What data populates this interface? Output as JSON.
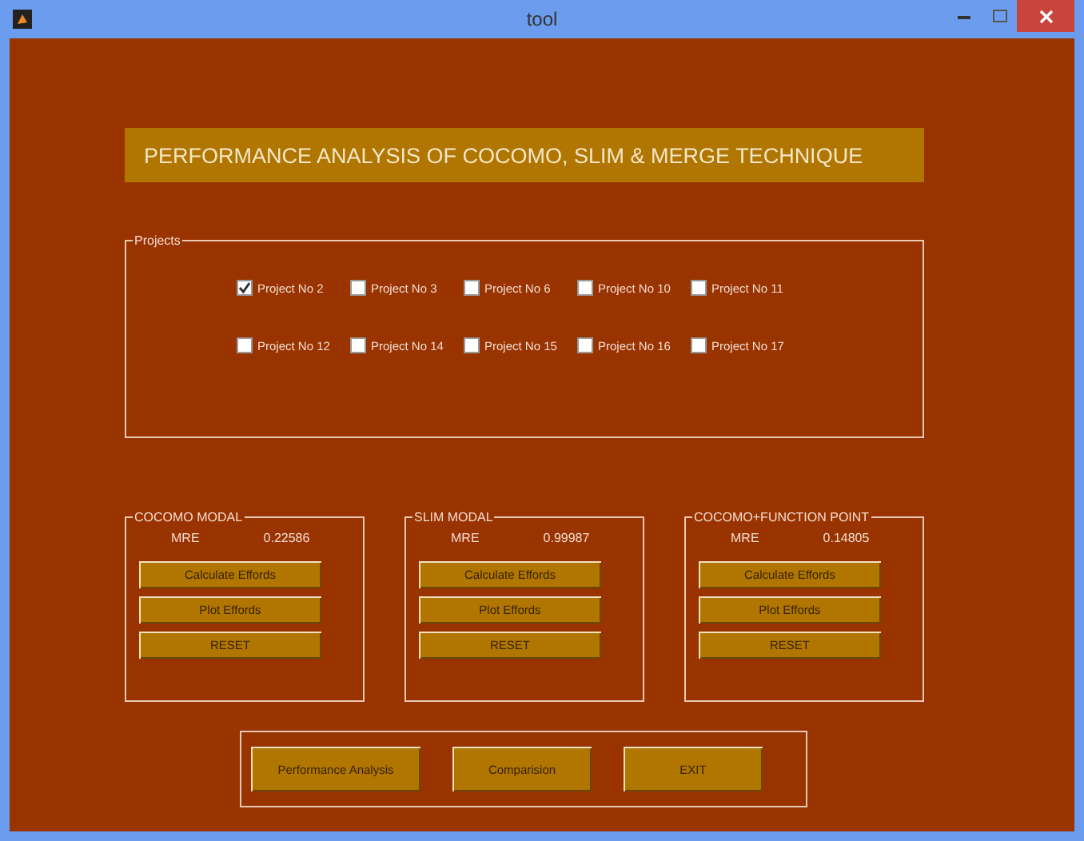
{
  "window": {
    "title": "tool"
  },
  "heading": "PERFORMANCE ANALYSIS OF COCOMO, SLIM & MERGE TECHNIQUE",
  "projects": {
    "title": "Projects",
    "items": [
      {
        "label": "Project No 2",
        "checked": true
      },
      {
        "label": "Project No 3",
        "checked": false
      },
      {
        "label": "Project No 6",
        "checked": false
      },
      {
        "label": "Project No 10",
        "checked": false
      },
      {
        "label": "Project No 11",
        "checked": false
      },
      {
        "label": "Project No 12",
        "checked": false
      },
      {
        "label": "Project No 14",
        "checked": false
      },
      {
        "label": "Project No 15",
        "checked": false
      },
      {
        "label": "Project No 16",
        "checked": false
      },
      {
        "label": "Project No 17",
        "checked": false
      }
    ]
  },
  "methods": [
    {
      "title": "COCOMO MODAL",
      "mre_label": "MRE",
      "mre_value": "0.22586",
      "buttons": [
        "Calculate Effords",
        "Plot Effords",
        "RESET"
      ]
    },
    {
      "title": "SLIM MODAL",
      "mre_label": "MRE",
      "mre_value": "0.99987",
      "buttons": [
        "Calculate Effords",
        "Plot Effords",
        "RESET"
      ]
    },
    {
      "title": "COCOMO+FUNCTION POINT",
      "mre_label": "MRE",
      "mre_value": "0.14805",
      "buttons": [
        "Calculate Effords",
        "Plot Effords",
        "RESET"
      ]
    }
  ],
  "actions": [
    "Performance Analysis",
    "Comparision",
    "EXIT"
  ]
}
